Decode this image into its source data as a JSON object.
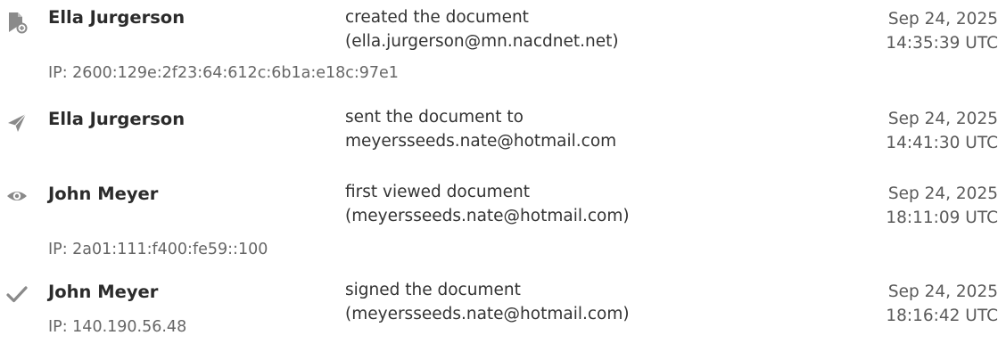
{
  "events": [
    {
      "icon": "document-created-icon",
      "name": "Ella Jurgerson",
      "action_line1": "created the document",
      "action_line2": "(ella.jurgerson@mn.nacdnet.net)",
      "date": "Sep 24, 2025",
      "time": "14:35:39 UTC",
      "ip": "IP: 2600:129e:2f23:64:612c:6b1a:e18c:97e1"
    },
    {
      "icon": "paper-plane-icon",
      "name": "Ella Jurgerson",
      "action_line1": "sent the document to",
      "action_line2": "meyersseeds.nate@hotmail.com",
      "date": "Sep 24, 2025",
      "time": "14:41:30 UTC"
    },
    {
      "icon": "eye-icon",
      "name": "John Meyer",
      "action_line1": "first viewed document",
      "action_line2": "(meyersseeds.nate@hotmail.com)",
      "date": "Sep 24, 2025",
      "time": "18:11:09 UTC",
      "ip": "IP: 2a01:111:f400:fe59::100"
    },
    {
      "icon": "checkmark-icon",
      "name": "John Meyer",
      "action_line1": "signed the document",
      "action_line2": "(meyersseeds.nate@hotmail.com)",
      "date": "Sep 24, 2025",
      "time": "18:16:42 UTC",
      "ip": "IP: 140.190.56.48"
    }
  ],
  "colors": {
    "icon": "#8a8a8a",
    "text": "#333333",
    "muted": "#666666"
  }
}
